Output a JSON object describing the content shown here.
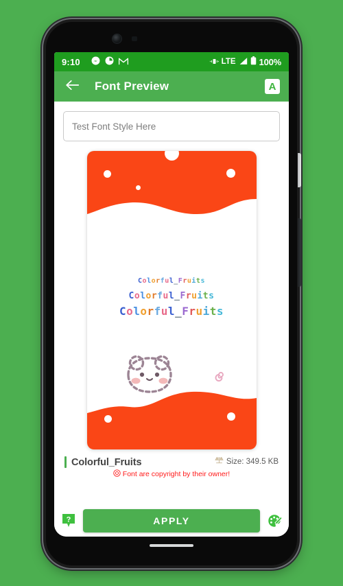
{
  "theme": {
    "wallpaper": "#4CAF50",
    "status_bar_bg": "#1f9d1f",
    "app_bar_bg": "#4CAF50",
    "accent_green": "#4CAF50",
    "card_orange": "#FA4616",
    "copyright_red": "#ff1a1a"
  },
  "status_bar": {
    "time": "9:10",
    "left_icons": [
      "messenger-icon",
      "circle-progress-icon",
      "gmail-icon"
    ],
    "right_icons": [
      "vibrate-icon",
      "signal-icon",
      "battery-icon"
    ],
    "network_label": "LTE",
    "battery_percent": "100%"
  },
  "app_bar": {
    "back_icon": "arrow-left-icon",
    "title": "Font Preview",
    "action_icon": "font-size-a-icon",
    "action_label": "A"
  },
  "test_input": {
    "value": "",
    "placeholder": "Test Font Style Here"
  },
  "preview_card": {
    "sample_text": "Colorful_Fruits",
    "sample_sizes": [
      "small",
      "medium",
      "large"
    ],
    "letter_colors": [
      "#3a5fd0",
      "#e86a8a",
      "#4a90e2",
      "#f0a030",
      "#e07a2a",
      "#6aa9e0",
      "#e86a8a",
      "#3a5fd0",
      "#7a8a95",
      "#9b6ad0",
      "#e05a5a",
      "#f0a030",
      "#4aa8d8",
      "#6ab04a",
      "#46b8d8"
    ],
    "illustration": "bear-face-icon",
    "doodle": "spiral-icon",
    "bubbles": 5
  },
  "font_info": {
    "name": "Colorful_Fruits",
    "size_icon": "scale-balance-icon",
    "size_label": "Size: 349.5 KB",
    "copyright_icon": "copyright-icon",
    "copyright_text": "Font are copyright by their owner!"
  },
  "bottom_bar": {
    "help_icon": "help-tooltip-icon",
    "apply_label": "APPLY",
    "palette_icon": "color-palette-icon"
  }
}
